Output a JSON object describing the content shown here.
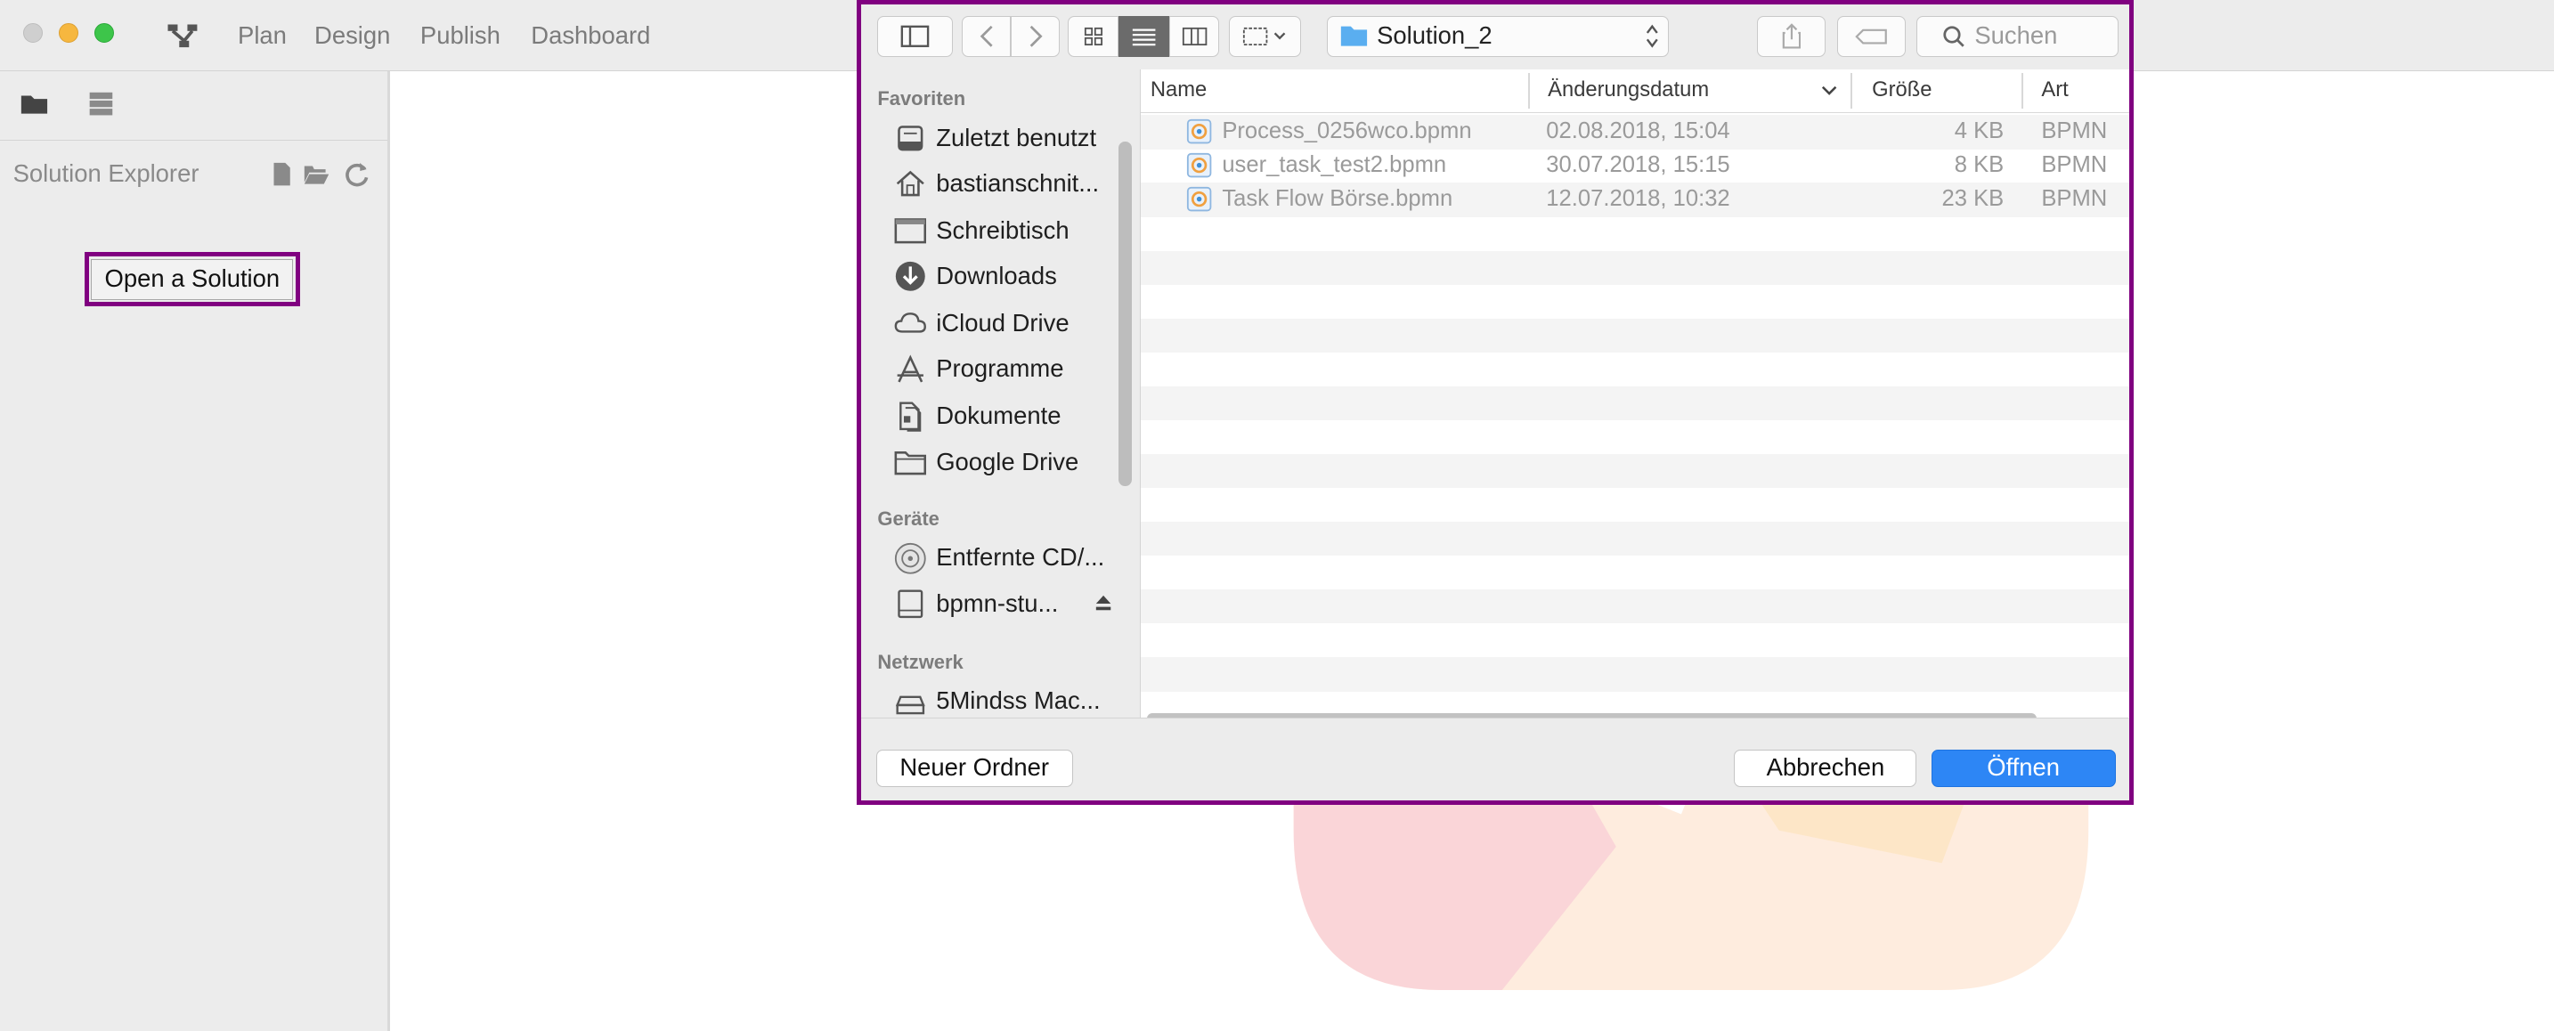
{
  "window": {
    "nav": [
      "Plan",
      "Design",
      "Publish",
      "Dashboard"
    ]
  },
  "sidebar": {
    "title": "Solution Explorer",
    "open_button": "Open a Solution"
  },
  "dialog": {
    "path": "Solution_2",
    "search_placeholder": "Suchen",
    "sections": {
      "favorites": "Favoriten",
      "devices": "Geräte",
      "network": "Netzwerk"
    },
    "favorites": [
      {
        "label": "Zuletzt benutzt",
        "icon": "recent-icon"
      },
      {
        "label": "bastianschnit...",
        "icon": "home-icon"
      },
      {
        "label": "Schreibtisch",
        "icon": "desktop-icon"
      },
      {
        "label": "Downloads",
        "icon": "download-icon"
      },
      {
        "label": "iCloud Drive",
        "icon": "cloud-icon"
      },
      {
        "label": "Programme",
        "icon": "applications-icon"
      },
      {
        "label": "Dokumente",
        "icon": "documents-icon"
      },
      {
        "label": "Google Drive",
        "icon": "folder-icon"
      }
    ],
    "devices": [
      {
        "label": "Entfernte CD/...",
        "icon": "disc-icon"
      },
      {
        "label": "bpmn-stu...",
        "icon": "disk-icon"
      }
    ],
    "network": [
      {
        "label": "5Mindss Mac...",
        "icon": "network-drive-icon"
      }
    ],
    "columns": [
      "Name",
      "Änderungsdatum",
      "Größe",
      "Art"
    ],
    "files": [
      {
        "name": "Process_0256wco.bpmn",
        "date": "02.08.2018, 15:04",
        "size": "4 KB",
        "kind": "BPMN"
      },
      {
        "name": "user_task_test2.bpmn",
        "date": "30.07.2018, 15:15",
        "size": "8 KB",
        "kind": "BPMN"
      },
      {
        "name": "Task Flow Börse.bpmn",
        "date": "12.07.2018, 10:32",
        "size": "23 KB",
        "kind": "BPMN"
      }
    ],
    "new_folder": "Neuer Ordner",
    "cancel": "Abbrechen",
    "open": "Öffnen"
  },
  "colors": {
    "highlight": "#800080",
    "primary_button": "#2d86f5"
  }
}
